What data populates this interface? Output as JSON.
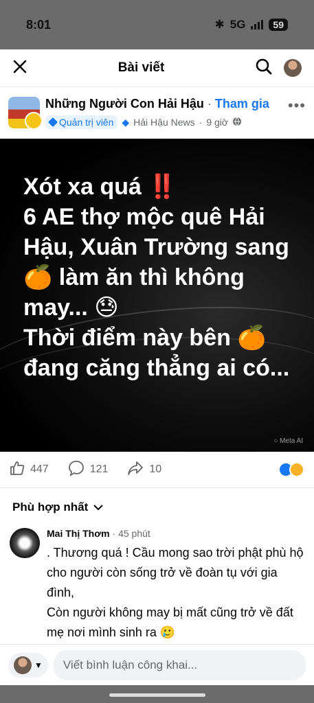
{
  "status": {
    "time": "8:01",
    "network": "5G",
    "battery": "59"
  },
  "topbar": {
    "title": "Bài viết",
    "close_icon": "close-icon",
    "search_icon": "search-icon"
  },
  "post": {
    "group_name": "Những Người Con Hải Hậu",
    "join_label": "Tham gia",
    "role_label": "Quản trị viên",
    "page_label": "Hải Hậu News",
    "time": "9 giờ",
    "visibility_icon": "globe-icon",
    "image_text": "Xót xa quá ‼️\n6 AE thợ mộc quê Hải Hậu, Xuân Trường sang 🍊 làm ăn thì không may... 😓\nThời điểm này bên 🍊 đang căng thẳng ai có...",
    "image_watermark": "Meta AI"
  },
  "actions": {
    "likes": "447",
    "comments": "121",
    "shares": "10"
  },
  "comments_sort": "Phù hợp nhất",
  "comment": {
    "author": "Mai Thị Thơm",
    "time": "45 phút",
    "text": ". Thương quá ! Cầu mong sao trời phật phù hộ cho người còn sống trở về đoàn tụ với gia đình,\nCòn người không may bị mất cũng trở về đất mẹ nơi mình sinh ra 🥲"
  },
  "composer": {
    "placeholder": "Viết bình luận công khai..."
  },
  "colors": {
    "accent": "#1877f2",
    "muted": "#65676b",
    "hero_bg": "#000000"
  }
}
